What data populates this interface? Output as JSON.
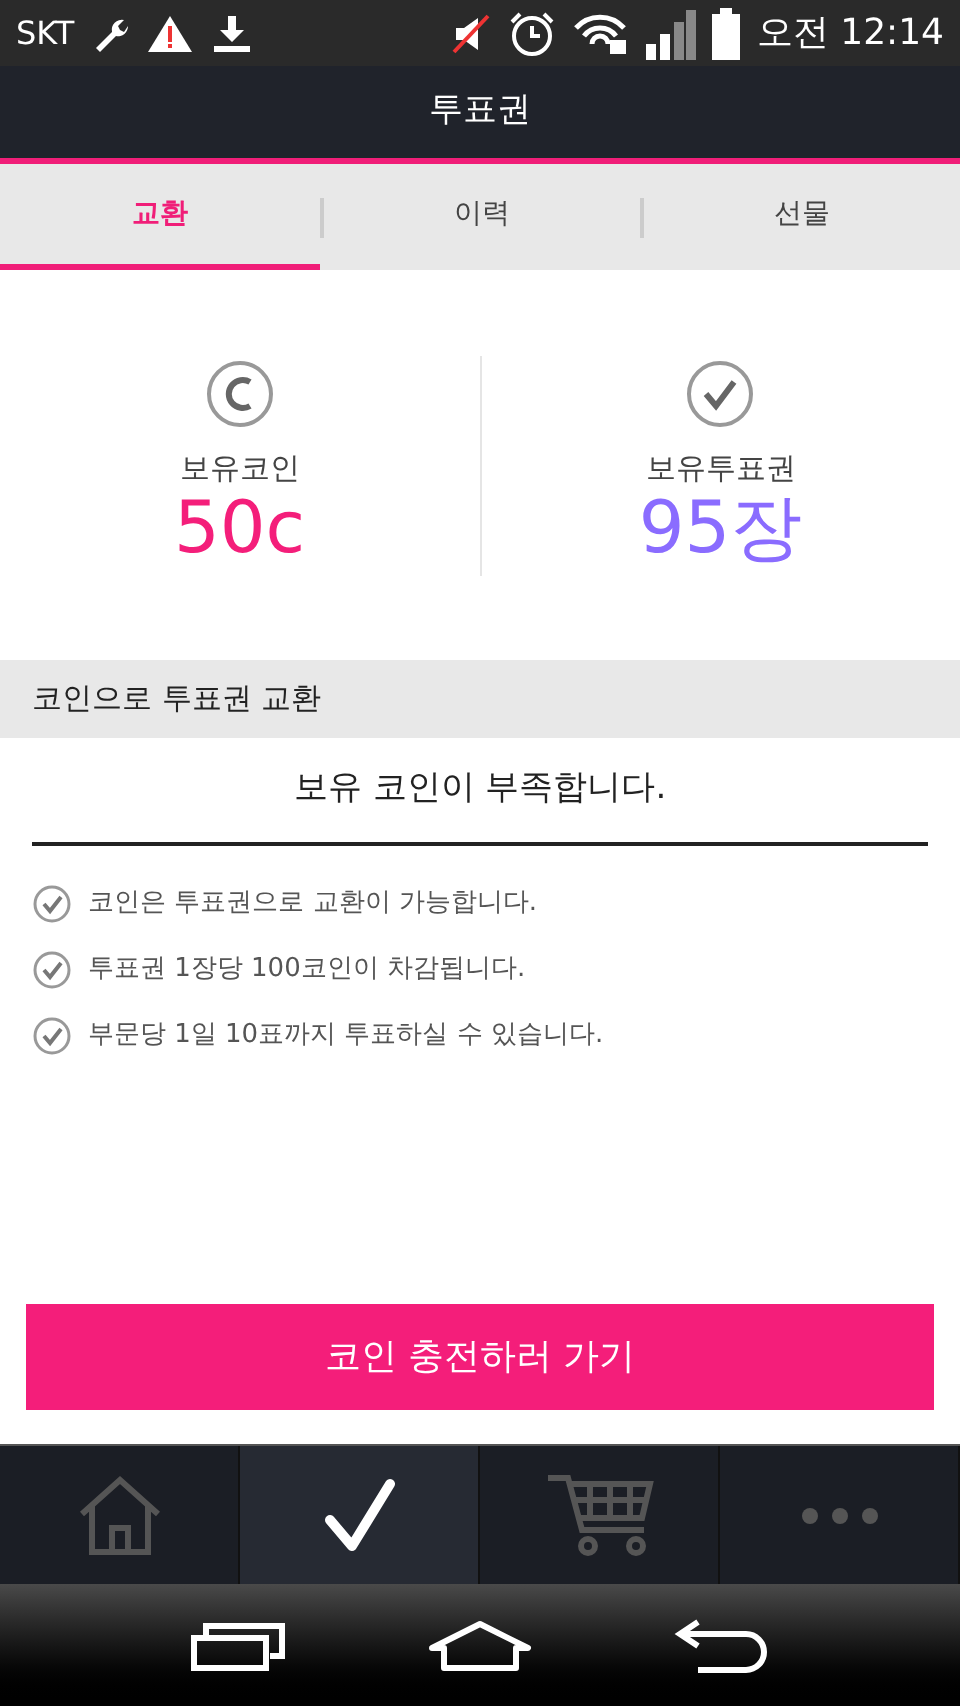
{
  "status_bar": {
    "carrier": "SKT",
    "time": "오전 12:14"
  },
  "header": {
    "title": "투표권"
  },
  "tabs": [
    {
      "label": "교환",
      "selected": true
    },
    {
      "label": "이력",
      "selected": false
    },
    {
      "label": "선물",
      "selected": false
    }
  ],
  "summary": [
    {
      "kind": "coin",
      "label": "보유코인",
      "value": "50c"
    },
    {
      "kind": "ticket",
      "label": "보유투표권",
      "value": "95장"
    }
  ],
  "section": {
    "title": "코인으로 투표권 교환",
    "message": "보유 코인이 부족합니다."
  },
  "notes": [
    "코인은 투표권으로 교환이 가능합니다.",
    "투표권 1장당 100코인이 차감됩니다.",
    "부문당 1일 10표까지 투표하실 수 있습니다."
  ],
  "charge_button": "코인 충전하러 가기",
  "bottom_nav": [
    {
      "kind": "home",
      "selected": false
    },
    {
      "kind": "check",
      "selected": true
    },
    {
      "kind": "cart",
      "selected": false
    },
    {
      "kind": "more",
      "selected": false
    }
  ]
}
